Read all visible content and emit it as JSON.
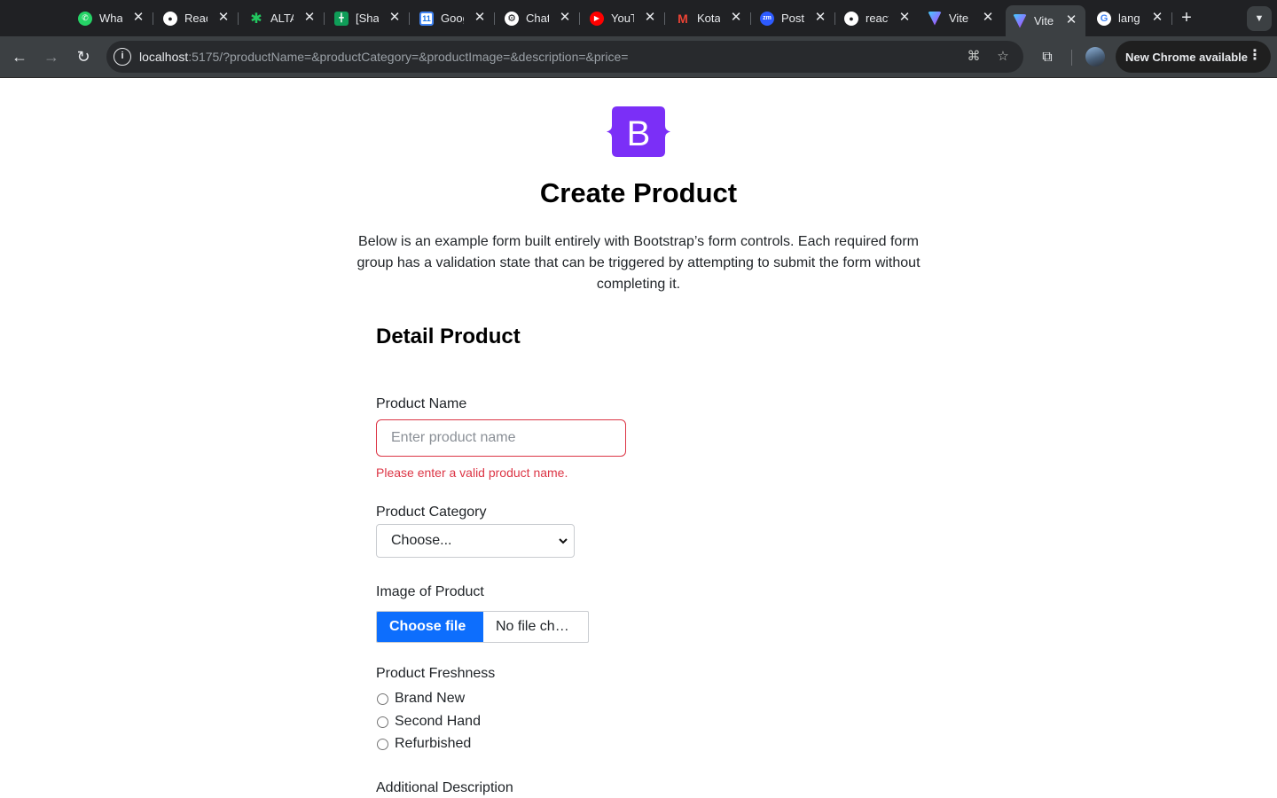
{
  "browser": {
    "tabs": [
      {
        "title": "WhatsApp",
        "icon": "whatsapp-icon",
        "color": "#25d366"
      },
      {
        "title": "React",
        "icon": "github-icon",
        "color": "#ffffff"
      },
      {
        "title": "ALTA",
        "icon": "asterisk-icon",
        "color": "#22c55e"
      },
      {
        "title": "[Sha",
        "icon": "sheets-icon",
        "color": "#0f9d58"
      },
      {
        "title": "Google",
        "icon": "calendar-icon",
        "color": "#4285f4"
      },
      {
        "title": "ChatGPT",
        "icon": "openai-icon",
        "color": "#ffffff"
      },
      {
        "title": "YouTube",
        "icon": "youtube-icon",
        "color": "#ff0000"
      },
      {
        "title": "Kota",
        "icon": "gmail-icon",
        "color": "#ea4335"
      },
      {
        "title": "Post",
        "icon": "zoom-icon",
        "color": "#2d5bff"
      },
      {
        "title": "react",
        "icon": "github-icon",
        "color": "#ffffff"
      },
      {
        "title": "Vite",
        "icon": "vite-icon",
        "color": "#a855f7"
      },
      {
        "title": "Vite",
        "icon": "vite-icon",
        "color": "#a855f7",
        "active": true
      },
      {
        "title": "lang",
        "icon": "google-icon",
        "color": "#4285f4"
      }
    ],
    "url_host": "localhost",
    "url_rest": ":5175/?productName=&productCategory=&productImage=&description=&price=",
    "update_label": "New Chrome available"
  },
  "page": {
    "logo_letter": "B",
    "logo_color": "#7b2ff7",
    "title": "Create Product",
    "lead": "Below is an example form built entirely with Bootstrap’s form controls. Each required form group has a validation state that can be triggered by attempting to submit the form without completing it.",
    "section_title": "Detail Product",
    "fields": {
      "product_name": {
        "label": "Product Name",
        "placeholder": "Enter product name",
        "value": "",
        "error": "Please enter a valid product name."
      },
      "product_category": {
        "label": "Product Category",
        "selected": "Choose..."
      },
      "product_image": {
        "label": "Image of Product",
        "button": "Choose file",
        "status": "No file ch…"
      },
      "freshness": {
        "label": "Product Freshness",
        "options": [
          "Brand New",
          "Second Hand",
          "Refurbished"
        ]
      },
      "description": {
        "label": "Additional Description"
      }
    },
    "colors": {
      "primary": "#0d6efd",
      "danger": "#dc3545"
    }
  }
}
